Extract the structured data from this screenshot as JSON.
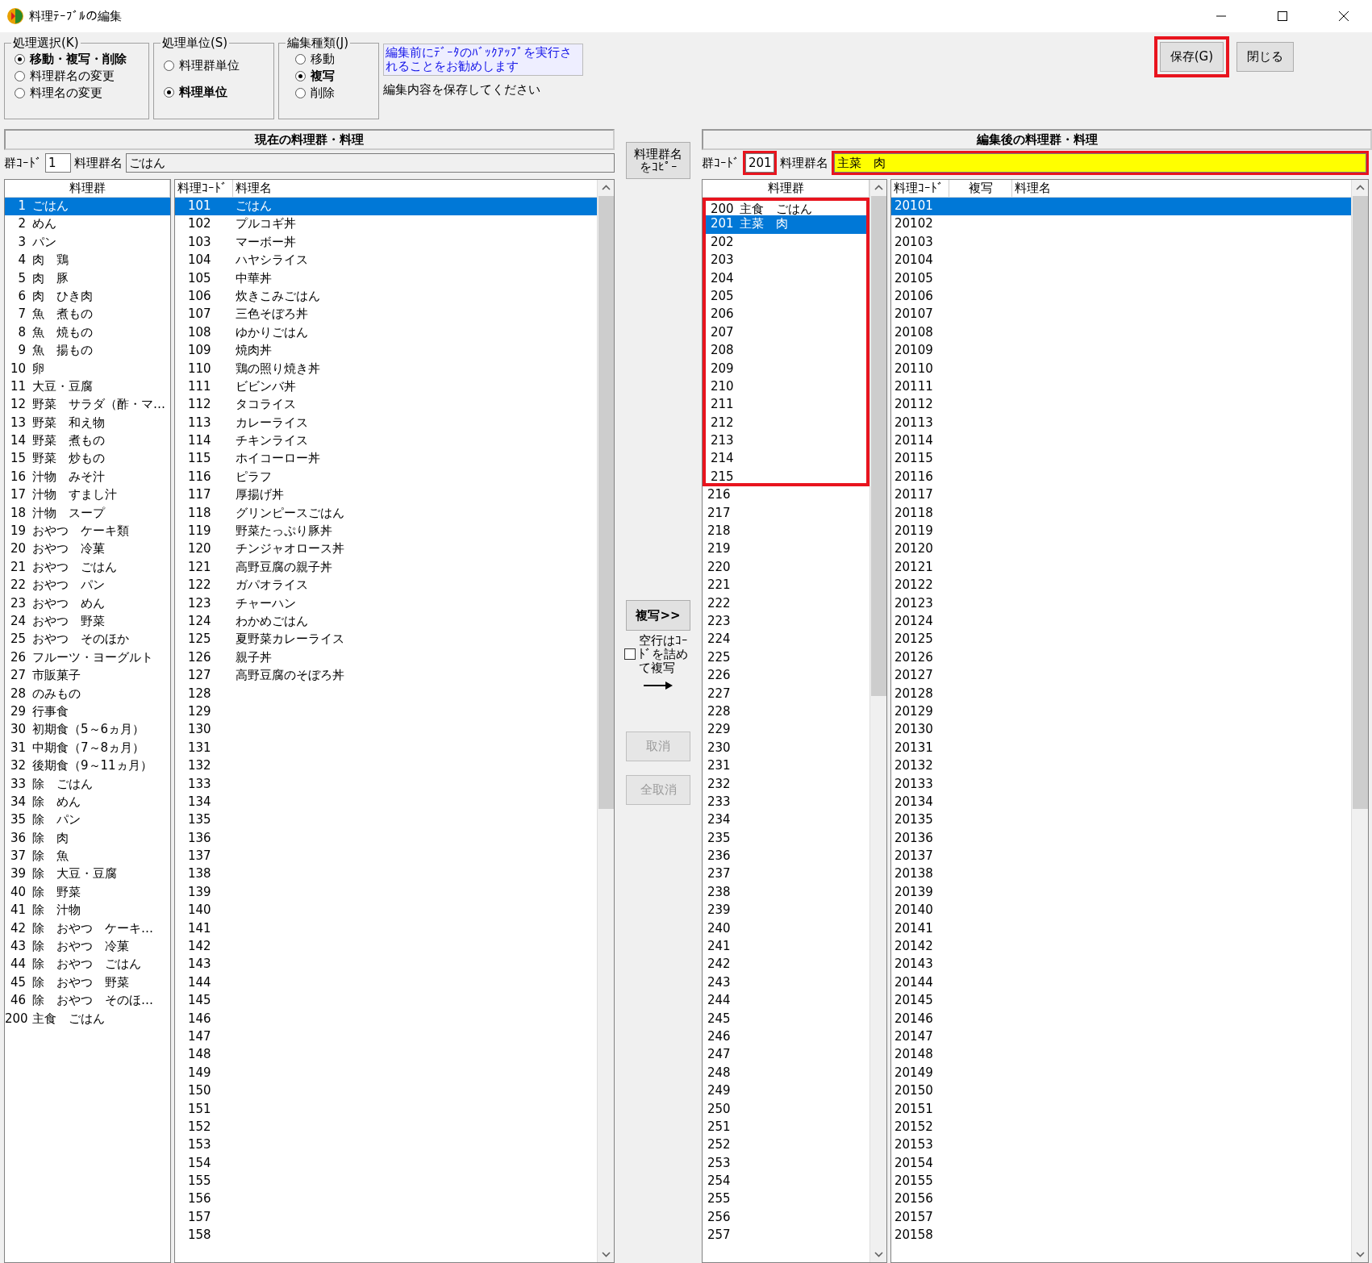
{
  "window": {
    "title": "料理ﾃｰﾌﾞﾙの編集"
  },
  "option_groups": [
    {
      "label": "処理選択(K)",
      "options": [
        {
          "label": "移動・複写・削除",
          "selected": true
        },
        {
          "label": "料理群名の変更",
          "selected": false
        },
        {
          "label": "料理名の変更",
          "selected": false
        }
      ]
    },
    {
      "label": "処理単位(S)",
      "options": [
        {
          "label": "料理群単位",
          "selected": false
        },
        {
          "label": "料理単位",
          "selected": true
        }
      ]
    },
    {
      "label": "編集種類(J)",
      "options": [
        {
          "label": "移動",
          "selected": false
        },
        {
          "label": "複写",
          "selected": true
        },
        {
          "label": "削除",
          "selected": false
        }
      ]
    }
  ],
  "notice": "編集前にﾃﾞｰﾀのﾊﾞｯｸｱｯﾌﾟを実行されることをお勧めします",
  "status_note": "編集内容を保存してください",
  "buttons": [
    {
      "label": "保存(G)",
      "highlighted": true
    },
    {
      "label": "閉じる",
      "highlighted": false
    }
  ],
  "current": {
    "title": "現在の料理群・料理",
    "code_label": "群ｺｰﾄﾞ",
    "code": "1",
    "name_label": "料理群名",
    "name": "ごはん",
    "group_list": {
      "header": "料理群",
      "items": [
        {
          "code": "1",
          "name": "ごはん",
          "selected": true
        },
        {
          "code": "2",
          "name": "めん",
          "selected": false
        },
        {
          "code": "3",
          "name": "パン",
          "selected": false
        },
        {
          "code": "4",
          "name": "肉　鶏",
          "selected": false
        },
        {
          "code": "5",
          "name": "肉　豚",
          "selected": false
        },
        {
          "code": "6",
          "name": "肉　ひき肉",
          "selected": false
        },
        {
          "code": "7",
          "name": "魚　煮もの",
          "selected": false
        },
        {
          "code": "8",
          "name": "魚　焼もの",
          "selected": false
        },
        {
          "code": "9",
          "name": "魚　揚もの",
          "selected": false
        },
        {
          "code": "10",
          "name": "卵",
          "selected": false
        },
        {
          "code": "11",
          "name": "大豆・豆腐",
          "selected": false
        },
        {
          "code": "12",
          "name": "野菜　サラダ（酢・マ…",
          "selected": false
        },
        {
          "code": "13",
          "name": "野菜　和え物",
          "selected": false
        },
        {
          "code": "14",
          "name": "野菜　煮もの",
          "selected": false
        },
        {
          "code": "15",
          "name": "野菜　炒もの",
          "selected": false
        },
        {
          "code": "16",
          "name": "汁物　みそ汁",
          "selected": false
        },
        {
          "code": "17",
          "name": "汁物　すまし汁",
          "selected": false
        },
        {
          "code": "18",
          "name": "汁物　スープ",
          "selected": false
        },
        {
          "code": "19",
          "name": "おやつ　ケーキ類",
          "selected": false
        },
        {
          "code": "20",
          "name": "おやつ　冷菓",
          "selected": false
        },
        {
          "code": "21",
          "name": "おやつ　ごはん",
          "selected": false
        },
        {
          "code": "22",
          "name": "おやつ　パン",
          "selected": false
        },
        {
          "code": "23",
          "name": "おやつ　めん",
          "selected": false
        },
        {
          "code": "24",
          "name": "おやつ　野菜",
          "selected": false
        },
        {
          "code": "25",
          "name": "おやつ　そのほか",
          "selected": false
        },
        {
          "code": "26",
          "name": "フルーツ・ヨーグルト",
          "selected": false
        },
        {
          "code": "27",
          "name": "市販菓子",
          "selected": false
        },
        {
          "code": "28",
          "name": "のみもの",
          "selected": false
        },
        {
          "code": "29",
          "name": "行事食",
          "selected": false
        },
        {
          "code": "30",
          "name": "初期食（5～6ヵ月）",
          "selected": false
        },
        {
          "code": "31",
          "name": "中期食（7～8ヵ月）",
          "selected": false
        },
        {
          "code": "32",
          "name": "後期食（9～11ヵ月）",
          "selected": false
        },
        {
          "code": "33",
          "name": "除　ごはん",
          "selected": false
        },
        {
          "code": "34",
          "name": "除　めん",
          "selected": false
        },
        {
          "code": "35",
          "name": "除　パン",
          "selected": false
        },
        {
          "code": "36",
          "name": "除　肉",
          "selected": false
        },
        {
          "code": "37",
          "name": "除　魚",
          "selected": false
        },
        {
          "code": "39",
          "name": "除　大豆・豆腐",
          "selected": false
        },
        {
          "code": "40",
          "name": "除　野菜",
          "selected": false
        },
        {
          "code": "41",
          "name": "除　汁物",
          "selected": false
        },
        {
          "code": "42",
          "name": "除　おやつ　ケーキ…",
          "selected": false
        },
        {
          "code": "43",
          "name": "除　おやつ　冷菓",
          "selected": false
        },
        {
          "code": "44",
          "name": "除　おやつ　ごはん",
          "selected": false
        },
        {
          "code": "45",
          "name": "除　おやつ　野菜",
          "selected": false
        },
        {
          "code": "46",
          "name": "除　おやつ　そのほ…",
          "selected": false
        },
        {
          "code": "200",
          "name": "主食　ごはん",
          "selected": false
        }
      ]
    },
    "dish_list": {
      "columns": [
        "料理ｺｰﾄﾞ",
        "料理名"
      ],
      "rows": [
        {
          "code": "101",
          "name": "ごはん",
          "selected": true
        },
        {
          "code": "102",
          "name": "プルコギ丼",
          "selected": false
        },
        {
          "code": "103",
          "name": "マーボー丼",
          "selected": false
        },
        {
          "code": "104",
          "name": "ハヤシライス",
          "selected": false
        },
        {
          "code": "105",
          "name": "中華丼",
          "selected": false
        },
        {
          "code": "106",
          "name": "炊きこみごはん",
          "selected": false
        },
        {
          "code": "107",
          "name": "三色そぼろ丼",
          "selected": false
        },
        {
          "code": "108",
          "name": "ゆかりごはん",
          "selected": false
        },
        {
          "code": "109",
          "name": "焼肉丼",
          "selected": false
        },
        {
          "code": "110",
          "name": "鶏の照り焼き丼",
          "selected": false
        },
        {
          "code": "111",
          "name": "ビビンバ丼",
          "selected": false
        },
        {
          "code": "112",
          "name": "タコライス",
          "selected": false
        },
        {
          "code": "113",
          "name": "カレーライス",
          "selected": false
        },
        {
          "code": "114",
          "name": "チキンライス",
          "selected": false
        },
        {
          "code": "115",
          "name": "ホイコーロー丼",
          "selected": false
        },
        {
          "code": "116",
          "name": "ピラフ",
          "selected": false
        },
        {
          "code": "117",
          "name": "厚揚げ丼",
          "selected": false
        },
        {
          "code": "118",
          "name": "グリンピースごはん",
          "selected": false
        },
        {
          "code": "119",
          "name": "野菜たっぷり豚丼",
          "selected": false
        },
        {
          "code": "120",
          "name": "チンジャオロース丼",
          "selected": false
        },
        {
          "code": "121",
          "name": "高野豆腐の親子丼",
          "selected": false
        },
        {
          "code": "122",
          "name": "ガパオライス",
          "selected": false
        },
        {
          "code": "123",
          "name": "チャーハン",
          "selected": false
        },
        {
          "code": "124",
          "name": "わかめごはん",
          "selected": false
        },
        {
          "code": "125",
          "name": "夏野菜カレーライス",
          "selected": false
        },
        {
          "code": "126",
          "name": "親子丼",
          "selected": false
        },
        {
          "code": "127",
          "name": "高野豆腐のそぼろ丼",
          "selected": false
        },
        {
          "code": "128",
          "selected": false
        },
        {
          "code": "129",
          "selected": false
        },
        {
          "code": "130",
          "selected": false
        },
        {
          "code": "131",
          "selected": false
        },
        {
          "code": "132",
          "selected": false
        },
        {
          "code": "133",
          "selected": false
        },
        {
          "code": "134",
          "selected": false
        },
        {
          "code": "135",
          "selected": false
        },
        {
          "code": "136",
          "selected": false
        },
        {
          "code": "137",
          "selected": false
        },
        {
          "code": "138",
          "selected": false
        },
        {
          "code": "139",
          "selected": false
        },
        {
          "code": "140",
          "selected": false
        },
        {
          "code": "141",
          "selected": false
        },
        {
          "code": "142",
          "selected": false
        },
        {
          "code": "143",
          "selected": false
        },
        {
          "code": "144",
          "selected": false
        },
        {
          "code": "145",
          "selected": false
        },
        {
          "code": "146",
          "selected": false
        },
        {
          "code": "147",
          "selected": false
        },
        {
          "code": "148",
          "selected": false
        },
        {
          "code": "149",
          "selected": false
        },
        {
          "code": "150",
          "selected": false
        },
        {
          "code": "151",
          "selected": false
        },
        {
          "code": "152",
          "selected": false
        },
        {
          "code": "153",
          "selected": false
        },
        {
          "code": "154",
          "selected": false
        },
        {
          "code": "155",
          "selected": false
        },
        {
          "code": "156",
          "selected": false
        },
        {
          "code": "157",
          "selected": false
        },
        {
          "code": "158",
          "selected": false
        }
      ]
    }
  },
  "middle": {
    "copy_name_button": "料理群名をｺﾋﾟｰ",
    "copy_button": {
      "label": "複写>>",
      "disabled": false
    },
    "compact_checkbox": {
      "label": "空行はｺｰﾄﾞを詰めて複写",
      "checked": false
    },
    "cancel_button": {
      "label": "取消",
      "disabled": true
    },
    "cancel_all_button": {
      "label": "全取消",
      "disabled": true
    }
  },
  "edited": {
    "title": "編集後の料理群・料理",
    "code_label": "群ｺｰﾄﾞ",
    "code": "201",
    "code_highlighted": true,
    "name_label": "料理群名",
    "name": "主菜　肉",
    "name_highlighted": true,
    "group_list": {
      "header": "料理群",
      "items": [
        {
          "code": "200",
          "name": "主食　ごはん",
          "selected": false,
          "highlighted": true
        },
        {
          "code": "201",
          "name": "主菜　肉",
          "selected": true,
          "highlighted": true
        },
        {
          "code": "202",
          "selected": false,
          "highlighted": true
        },
        {
          "code": "203",
          "selected": false,
          "highlighted": true
        },
        {
          "code": "204",
          "selected": false,
          "highlighted": true
        },
        {
          "code": "205",
          "selected": false,
          "highlighted": true
        },
        {
          "code": "206",
          "selected": false,
          "highlighted": true
        },
        {
          "code": "207",
          "selected": false,
          "highlighted": true
        },
        {
          "code": "208",
          "selected": false,
          "highlighted": true
        },
        {
          "code": "209",
          "selected": false,
          "highlighted": true
        },
        {
          "code": "210",
          "selected": false,
          "highlighted": true
        },
        {
          "code": "211",
          "selected": false,
          "highlighted": true
        },
        {
          "code": "212",
          "selected": false,
          "highlighted": true
        },
        {
          "code": "213",
          "selected": false,
          "highlighted": true
        },
        {
          "code": "214",
          "selected": false,
          "highlighted": true
        },
        {
          "code": "215",
          "selected": false,
          "highlighted": true
        },
        {
          "code": "216",
          "selected": false,
          "highlighted": false
        },
        {
          "code": "217",
          "selected": false,
          "highlighted": false
        },
        {
          "code": "218",
          "selected": false,
          "highlighted": false
        },
        {
          "code": "219",
          "selected": false,
          "highlighted": false
        },
        {
          "code": "220",
          "selected": false,
          "highlighted": false
        },
        {
          "code": "221",
          "selected": false,
          "highlighted": false
        },
        {
          "code": "222",
          "selected": false,
          "highlighted": false
        },
        {
          "code": "223",
          "selected": false,
          "highlighted": false
        },
        {
          "code": "224",
          "selected": false,
          "highlighted": false
        },
        {
          "code": "225",
          "selected": false,
          "highlighted": false
        },
        {
          "code": "226",
          "selected": false,
          "highlighted": false
        },
        {
          "code": "227",
          "selected": false,
          "highlighted": false
        },
        {
          "code": "228",
          "selected": false,
          "highlighted": false
        },
        {
          "code": "229",
          "selected": false,
          "highlighted": false
        },
        {
          "code": "230",
          "selected": false,
          "highlighted": false
        },
        {
          "code": "231",
          "selected": false,
          "highlighted": false
        },
        {
          "code": "232",
          "selected": false,
          "highlighted": false
        },
        {
          "code": "233",
          "selected": false,
          "highlighted": false
        },
        {
          "code": "234",
          "selected": false,
          "highlighted": false
        },
        {
          "code": "235",
          "selected": false,
          "highlighted": false
        },
        {
          "code": "236",
          "selected": false,
          "highlighted": false
        },
        {
          "code": "237",
          "selected": false,
          "highlighted": false
        },
        {
          "code": "238",
          "selected": false,
          "highlighted": false
        },
        {
          "code": "239",
          "selected": false,
          "highlighted": false
        },
        {
          "code": "240",
          "selected": false,
          "highlighted": false
        },
        {
          "code": "241",
          "selected": false,
          "highlighted": false
        },
        {
          "code": "242",
          "selected": false,
          "highlighted": false
        },
        {
          "code": "243",
          "selected": false,
          "highlighted": false
        },
        {
          "code": "244",
          "selected": false,
          "highlighted": false
        },
        {
          "code": "245",
          "selected": false,
          "highlighted": false
        },
        {
          "code": "246",
          "selected": false,
          "highlighted": false
        },
        {
          "code": "247",
          "selected": false,
          "highlighted": false
        },
        {
          "code": "248",
          "selected": false,
          "highlighted": false
        },
        {
          "code": "249",
          "selected": false,
          "highlighted": false
        },
        {
          "code": "250",
          "selected": false,
          "highlighted": false
        },
        {
          "code": "251",
          "selected": false,
          "highlighted": false
        },
        {
          "code": "252",
          "selected": false,
          "highlighted": false
        },
        {
          "code": "253",
          "selected": false,
          "highlighted": false
        },
        {
          "code": "254",
          "selected": false,
          "highlighted": false
        },
        {
          "code": "255",
          "selected": false,
          "highlighted": false
        },
        {
          "code": "256",
          "selected": false,
          "highlighted": false
        },
        {
          "code": "257",
          "selected": false,
          "highlighted": false
        }
      ]
    },
    "dish_list": {
      "columns": [
        "料理ｺｰﾄﾞ",
        "複写",
        "料理名"
      ],
      "rows": [
        {
          "code": "20101",
          "selected": true
        },
        {
          "code": "20102",
          "selected": false
        },
        {
          "code": "20103",
          "selected": false
        },
        {
          "code": "20104",
          "selected": false
        },
        {
          "code": "20105",
          "selected": false
        },
        {
          "code": "20106",
          "selected": false
        },
        {
          "code": "20107",
          "selected": false
        },
        {
          "code": "20108",
          "selected": false
        },
        {
          "code": "20109",
          "selected": false
        },
        {
          "code": "20110",
          "selected": false
        },
        {
          "code": "20111",
          "selected": false
        },
        {
          "code": "20112",
          "selected": false
        },
        {
          "code": "20113",
          "selected": false
        },
        {
          "code": "20114",
          "selected": false
        },
        {
          "code": "20115",
          "selected": false
        },
        {
          "code": "20116",
          "selected": false
        },
        {
          "code": "20117",
          "selected": false
        },
        {
          "code": "20118",
          "selected": false
        },
        {
          "code": "20119",
          "selected": false
        },
        {
          "code": "20120",
          "selected": false
        },
        {
          "code": "20121",
          "selected": false
        },
        {
          "code": "20122",
          "selected": false
        },
        {
          "code": "20123",
          "selected": false
        },
        {
          "code": "20124",
          "selected": false
        },
        {
          "code": "20125",
          "selected": false
        },
        {
          "code": "20126",
          "selected": false
        },
        {
          "code": "20127",
          "selected": false
        },
        {
          "code": "20128",
          "selected": false
        },
        {
          "code": "20129",
          "selected": false
        },
        {
          "code": "20130",
          "selected": false
        },
        {
          "code": "20131",
          "selected": false
        },
        {
          "code": "20132",
          "selected": false
        },
        {
          "code": "20133",
          "selected": false
        },
        {
          "code": "20134",
          "selected": false
        },
        {
          "code": "20135",
          "selected": false
        },
        {
          "code": "20136",
          "selected": false
        },
        {
          "code": "20137",
          "selected": false
        },
        {
          "code": "20138",
          "selected": false
        },
        {
          "code": "20139",
          "selected": false
        },
        {
          "code": "20140",
          "selected": false
        },
        {
          "code": "20141",
          "selected": false
        },
        {
          "code": "20142",
          "selected": false
        },
        {
          "code": "20143",
          "selected": false
        },
        {
          "code": "20144",
          "selected": false
        },
        {
          "code": "20145",
          "selected": false
        },
        {
          "code": "20146",
          "selected": false
        },
        {
          "code": "20147",
          "selected": false
        },
        {
          "code": "20148",
          "selected": false
        },
        {
          "code": "20149",
          "selected": false
        },
        {
          "code": "20150",
          "selected": false
        },
        {
          "code": "20151",
          "selected": false
        },
        {
          "code": "20152",
          "selected": false
        },
        {
          "code": "20153",
          "selected": false
        },
        {
          "code": "20154",
          "selected": false
        },
        {
          "code": "20155",
          "selected": false
        },
        {
          "code": "20156",
          "selected": false
        },
        {
          "code": "20157",
          "selected": false
        },
        {
          "code": "20158",
          "selected": false
        }
      ]
    }
  }
}
